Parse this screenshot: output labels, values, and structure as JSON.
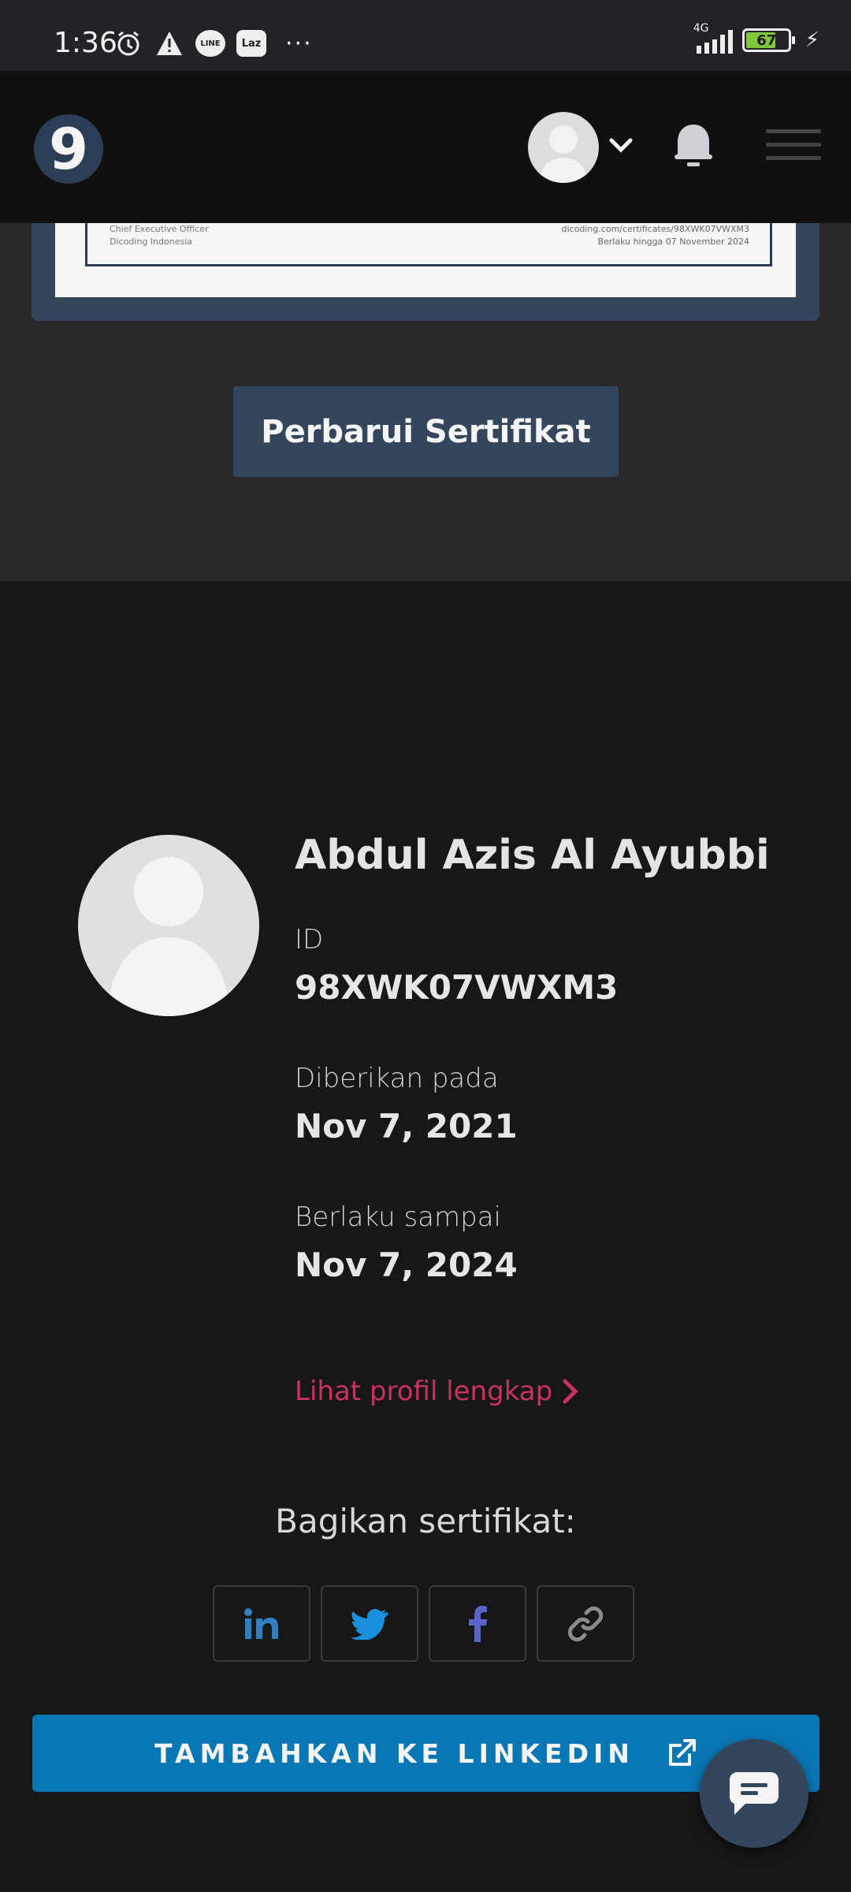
{
  "status_bar": {
    "time": "1:36",
    "app_icons": [
      "alarm-icon",
      "warning-icon",
      "line-icon",
      "lazada-icon"
    ],
    "line_label": "LINE",
    "laz_label": "Laz",
    "more": "···",
    "network": "4G",
    "battery": "67"
  },
  "header": {
    "logo_text": "9"
  },
  "certificate_preview": {
    "signer_title": "Chief Executive Officer",
    "signer_org": "Dicoding Indonesia",
    "cert_url": "dicoding.com/certificates/98XWK07VWXM3",
    "valid_until": "Berlaku hingga 07 November 2024"
  },
  "renew_button": "Perbarui Sertifikat",
  "profile": {
    "name": "Abdul Azis Al Ayubbi",
    "id_label": "ID",
    "id_value": "98XWK07VWXM3",
    "issued_label": "Diberikan pada",
    "issued_value": "Nov 7, 2021",
    "expires_label": "Berlaku sampai",
    "expires_value": "Nov 7, 2024",
    "full_profile_link": "Lihat profil lengkap"
  },
  "share": {
    "label": "Bagikan sertifikat:",
    "buttons": [
      "linkedin-icon",
      "twitter-icon",
      "facebook-icon",
      "link-icon"
    ]
  },
  "linkedin_button": "TAMBAHKAN KE LINKEDIN",
  "colors": {
    "accent_link": "#c8325d",
    "linkedin_blue": "#0a77b5",
    "brand_navy": "#34465c"
  }
}
